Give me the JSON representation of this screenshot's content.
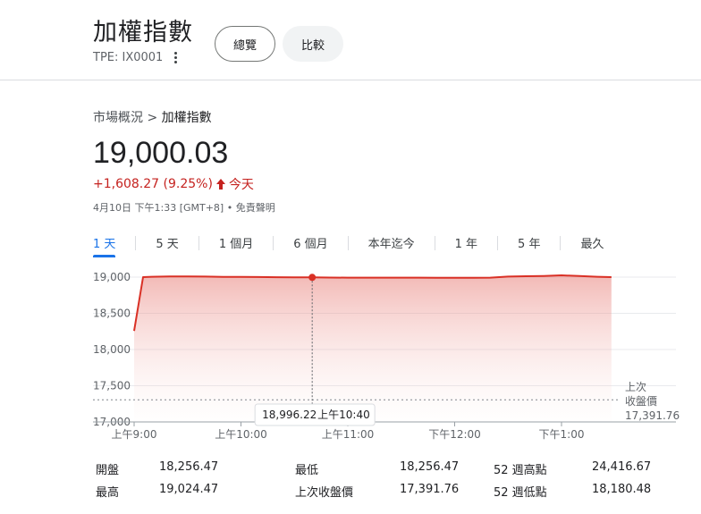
{
  "header": {
    "title": "加權指數",
    "ticker": "TPE: IX0001",
    "buttons": {
      "overview": "總覽",
      "compare": "比較"
    }
  },
  "breadcrumb": {
    "parent": "市場概況",
    "separator": ">",
    "current": "加權指數"
  },
  "quote": {
    "price": "19,000.03",
    "change": "+1,608.27 (9.25%)",
    "change_period": "今天",
    "timestamp": "4月10日 下午1:33 [GMT+8] • 免責聲明",
    "change_color": "#c5221f"
  },
  "tabs": [
    "1 天",
    "5 天",
    "1 個月",
    "6 個月",
    "本年迄今",
    "1 年",
    "5 年",
    "最久"
  ],
  "active_tab": 0,
  "chart_data": {
    "type": "area",
    "y_ticks": [
      "19,000",
      "18,500",
      "18,000",
      "17,500",
      "17,000"
    ],
    "x_ticks": [
      "上午9:00",
      "上午10:00",
      "上午11:00",
      "下午12:00",
      "下午1:00"
    ],
    "ylim": [
      17000,
      19000
    ],
    "line_color": "#d93025",
    "previous_close": {
      "label_1": "上次",
      "label_2": "收盤價",
      "value": 17391.76,
      "display": "17,391.76"
    },
    "tooltip": {
      "value": "18,996.22",
      "time": "上午10:40"
    },
    "series": [
      {
        "x_minutes": [
          0,
          5,
          10,
          20,
          30,
          40,
          50,
          60,
          70,
          80,
          90,
          100,
          110,
          120,
          130,
          140,
          150,
          160,
          170,
          180,
          190,
          200,
          210,
          220,
          230,
          240,
          250,
          260,
          268
        ],
        "y": [
          18256.47,
          19000,
          19005,
          19010,
          19010,
          19008,
          19004,
          19002,
          19001,
          18999,
          18998,
          18996.22,
          18994,
          18993,
          18992,
          18993,
          18992,
          18992,
          18990,
          18991,
          18990,
          18992,
          19008,
          19012,
          19016,
          19024.47,
          19015,
          19005,
          19000.03
        ]
      }
    ],
    "grid": true
  },
  "stats": {
    "col1": [
      {
        "label": "開盤",
        "value": "18,256.47"
      },
      {
        "label": "最高",
        "value": "19,024.47"
      }
    ],
    "col2": [
      {
        "label": "最低",
        "value": "18,256.47"
      },
      {
        "label": "上次收盤價",
        "value": "17,391.76"
      }
    ],
    "col3": [
      {
        "label": "52 週高點",
        "value": "24,416.67"
      },
      {
        "label": "52 週低點",
        "value": "18,180.48"
      }
    ]
  }
}
